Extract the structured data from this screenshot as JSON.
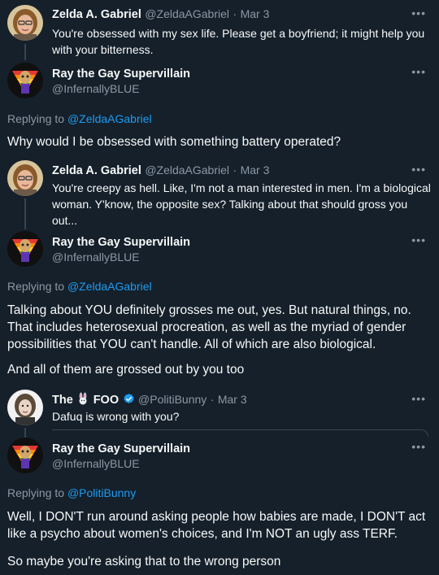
{
  "tweet1": {
    "name": "Zelda A. Gabriel",
    "handle": "@ZeldaAGabriel",
    "sep": "·",
    "date": "Mar 3",
    "text": "You're obsessed with my sex life. Please get a boyfriend; it might help you with your bitterness."
  },
  "reply1": {
    "name": "Ray the Gay Supervillain",
    "handle": "@InfernallyBLUE",
    "replying_prefix": "Replying to",
    "replying_to": "@ZeldaAGabriel",
    "text": "Why would I be obsessed with something battery operated?"
  },
  "tweet2": {
    "name": "Zelda A. Gabriel",
    "handle": "@ZeldaAGabriel",
    "sep": "·",
    "date": "Mar 3",
    "text": "You're creepy as hell. Like, I'm not a man interested in men. I'm a biological woman. Y'know, the opposite sex? Talking about that should gross you out..."
  },
  "reply2": {
    "name": "Ray the Gay Supervillain",
    "handle": "@InfernallyBLUE",
    "replying_prefix": "Replying to",
    "replying_to": "@ZeldaAGabriel",
    "text_p1": "Talking about YOU definitely grosses me out, yes. But natural things, no. That includes heterosexual procreation, as well as the myriad of gender possibilities that YOU can't handle. All of which are also biological.",
    "text_p2": "And all of them are grossed out by you too"
  },
  "tweet3": {
    "name_part1": "The",
    "name_part2": "FOO",
    "handle": "@PolitiBunny",
    "sep": "·",
    "date": "Mar 3",
    "text": "Dafuq is wrong with you?"
  },
  "reply3": {
    "name": "Ray the Gay Supervillain",
    "handle": "@InfernallyBLUE",
    "replying_prefix": "Replying to",
    "replying_to": "@PolitiBunny",
    "text_p1": "Well, I DON'T run around asking people how babies are made, I DON'T act like a psycho about women's choices, and I'm NOT an ugly ass TERF.",
    "text_p2": "So maybe you're asking that to the wrong person"
  },
  "more_label": "•••",
  "colors": {
    "background": "#15202b",
    "text": "#f7f9f9",
    "secondary": "#8b98a5",
    "link": "#1d9bf0",
    "verified": "#1d9bf0"
  },
  "icons": [
    "more-icon",
    "verified-badge-icon",
    "bunny-emoji-icon"
  ]
}
